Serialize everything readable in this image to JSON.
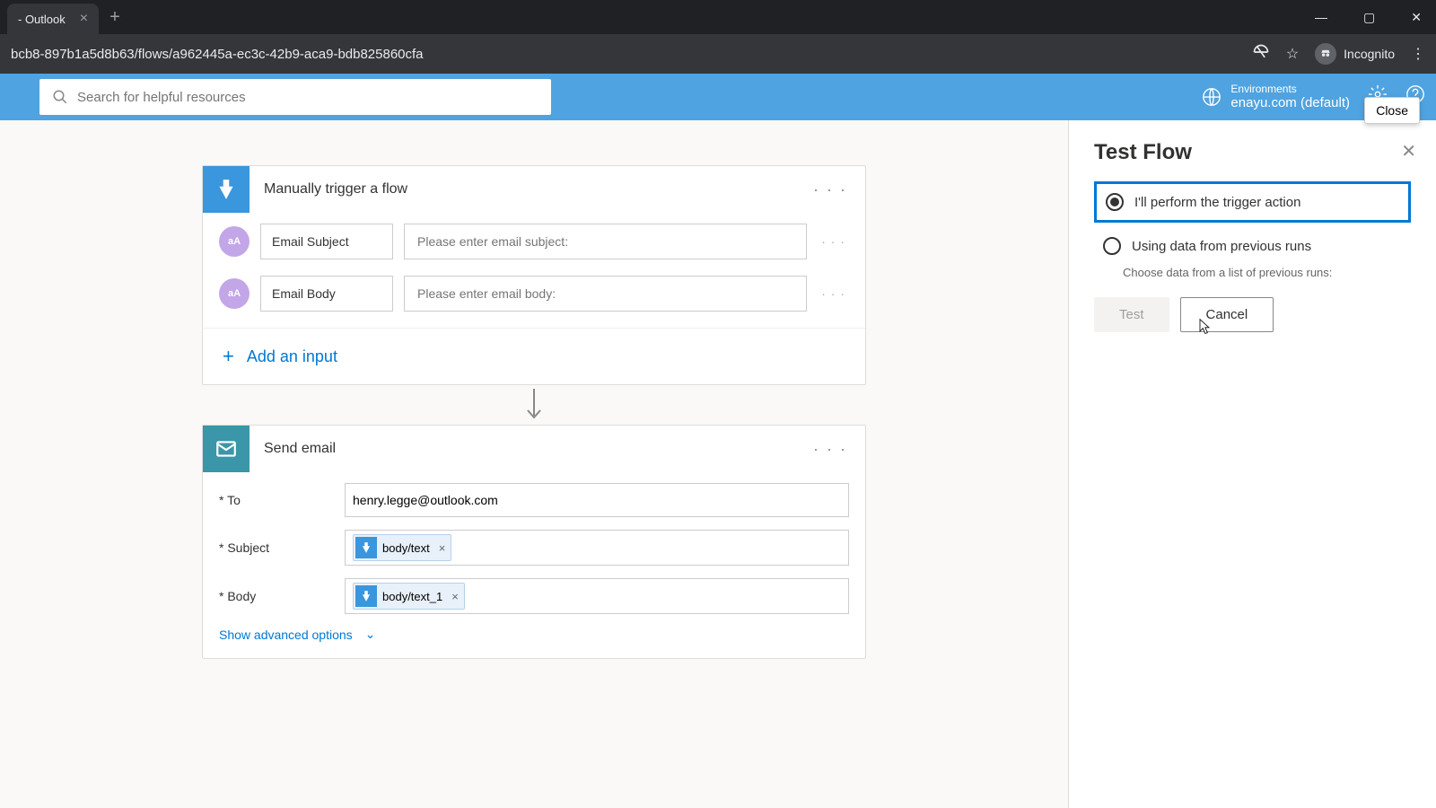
{
  "browser": {
    "tab_title": "- Outlook",
    "url": "bcb8-897b1a5d8b63/flows/a962445a-ec3c-42b9-aca9-bdb825860cfa",
    "incognito_label": "Incognito"
  },
  "header": {
    "search_placeholder": "Search for helpful resources",
    "env_label": "Environments",
    "env_name": "enayu.com (default)",
    "close_tooltip": "Close"
  },
  "trigger_card": {
    "title": "Manually trigger a flow",
    "inputs": [
      {
        "icon_text": "aA",
        "label": "Email Subject",
        "placeholder": "Please enter email subject:"
      },
      {
        "icon_text": "aA",
        "label": "Email Body",
        "placeholder": "Please enter email body:"
      }
    ],
    "add_input_label": "Add an input"
  },
  "email_card": {
    "title": "Send email",
    "fields": {
      "to_label": "* To",
      "to_value": "henry.legge@outlook.com",
      "subject_label": "* Subject",
      "subject_token": "body/text",
      "body_label": "* Body",
      "body_token": "body/text_1"
    },
    "show_advanced": "Show advanced options"
  },
  "test_panel": {
    "title": "Test Flow",
    "option1": "I'll perform the trigger action",
    "option2": "Using data from previous runs",
    "option2_sub": "Choose data from a list of previous runs:",
    "test_btn": "Test",
    "cancel_btn": "Cancel"
  }
}
